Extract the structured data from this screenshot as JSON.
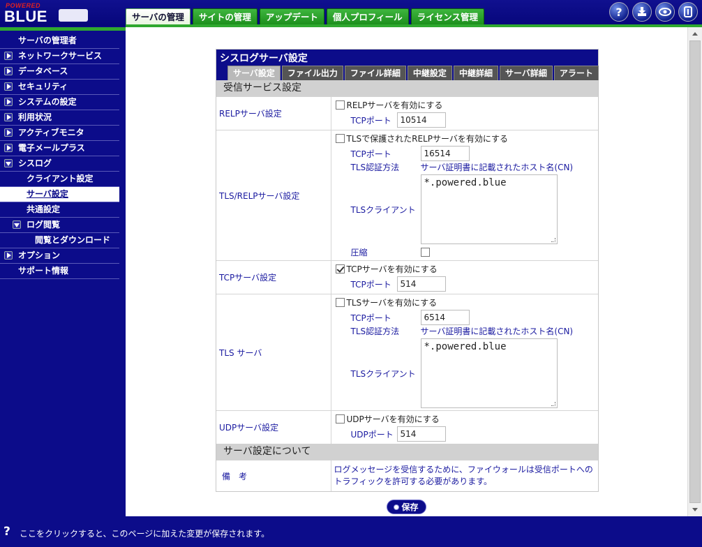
{
  "header": {
    "logo_small": "POWERED",
    "logo_big": "BLUE",
    "tabs": [
      {
        "label": "サーバの管理",
        "active": true
      },
      {
        "label": "サイトの管理",
        "active": false
      },
      {
        "label": "アップデート",
        "active": false
      },
      {
        "label": "個人プロフィール",
        "active": false
      },
      {
        "label": "ライセンス管理",
        "active": false
      }
    ],
    "icons": [
      "help-icon",
      "download-icon",
      "eye-icon",
      "logout-icon"
    ]
  },
  "sidebar": {
    "items": [
      {
        "label": "サーバの管理者",
        "level": 0,
        "arrow": "none"
      },
      {
        "label": "ネットワークサービス",
        "level": 0,
        "arrow": "right"
      },
      {
        "label": "データベース",
        "level": 0,
        "arrow": "right"
      },
      {
        "label": "セキュリティ",
        "level": 0,
        "arrow": "right"
      },
      {
        "label": "システムの設定",
        "level": 0,
        "arrow": "right"
      },
      {
        "label": "利用状況",
        "level": 0,
        "arrow": "right"
      },
      {
        "label": "アクティブモニタ",
        "level": 0,
        "arrow": "right"
      },
      {
        "label": "電子メールプラス",
        "level": 0,
        "arrow": "right"
      },
      {
        "label": "シスログ",
        "level": 0,
        "arrow": "down"
      },
      {
        "label": "クライアント設定",
        "level": 1,
        "arrow": "none"
      },
      {
        "label": "サーバ設定",
        "level": 1,
        "arrow": "none",
        "active": true
      },
      {
        "label": "共通設定",
        "level": 1,
        "arrow": "none"
      },
      {
        "label": "ログ閲覧",
        "level": 1,
        "arrow": "down"
      },
      {
        "label": "閲覧とダウンロード",
        "level": 2,
        "arrow": "none"
      },
      {
        "label": "オプション",
        "level": 0,
        "arrow": "right"
      },
      {
        "label": "サポート情報",
        "level": 0,
        "arrow": "none"
      }
    ]
  },
  "panel": {
    "title": "シスログサーバ設定",
    "subtabs": [
      {
        "label": "サーバ設定",
        "active": true
      },
      {
        "label": "ファイル出力",
        "active": false
      },
      {
        "label": "ファイル詳細",
        "active": false
      },
      {
        "label": "中継設定",
        "active": false
      },
      {
        "label": "中継詳細",
        "active": false
      },
      {
        "label": "サーバ詳細",
        "active": false
      },
      {
        "label": "アラート",
        "active": false
      }
    ],
    "section1": "受信サービス設定",
    "relp": {
      "label": "RELPサーバ設定",
      "enable": "RELPサーバを有効にする",
      "port_label": "TCPポート",
      "port": "10514"
    },
    "tls_relp": {
      "label": "TLS/RELPサーバ設定",
      "enable": "TLSで保護されたRELPサーバを有効にする",
      "port_label": "TCPポート",
      "port": "16514",
      "auth_label": "TLS認証方法",
      "auth_value": "サーバ証明書に記載されたホスト名(CN)",
      "client_label": "TLSクライアント",
      "client_value": "*.powered.blue",
      "compress_label": "圧縮"
    },
    "tcp": {
      "label": "TCPサーバ設定",
      "enable": "TCPサーバを有効にする",
      "port_label": "TCPポート",
      "port": "514"
    },
    "tls": {
      "label": "TLS サーバ",
      "enable": "TLSサーバを有効にする",
      "port_label": "TCPポート",
      "port": "6514",
      "auth_label": "TLS認証方法",
      "auth_value": "サーバ証明書に記載されたホスト名(CN)",
      "client_label": "TLSクライアント",
      "client_value": "*.powered.blue"
    },
    "udp": {
      "label": "UDPサーバ設定",
      "enable": "UDPサーバを有効にする",
      "port_label": "UDPポート",
      "port": "514"
    },
    "section2": "サーバ設定について",
    "note_label": "備　考",
    "note_line1": "ログメッセージを受信するために、ファイウォールは受信ポートへの",
    "note_line2": "トラフィックを許可する必要があります。"
  },
  "save_label": "保存",
  "footer": {
    "icon": "?",
    "message": "ここをクリックすると、このページに加えた変更が保存されます。"
  }
}
